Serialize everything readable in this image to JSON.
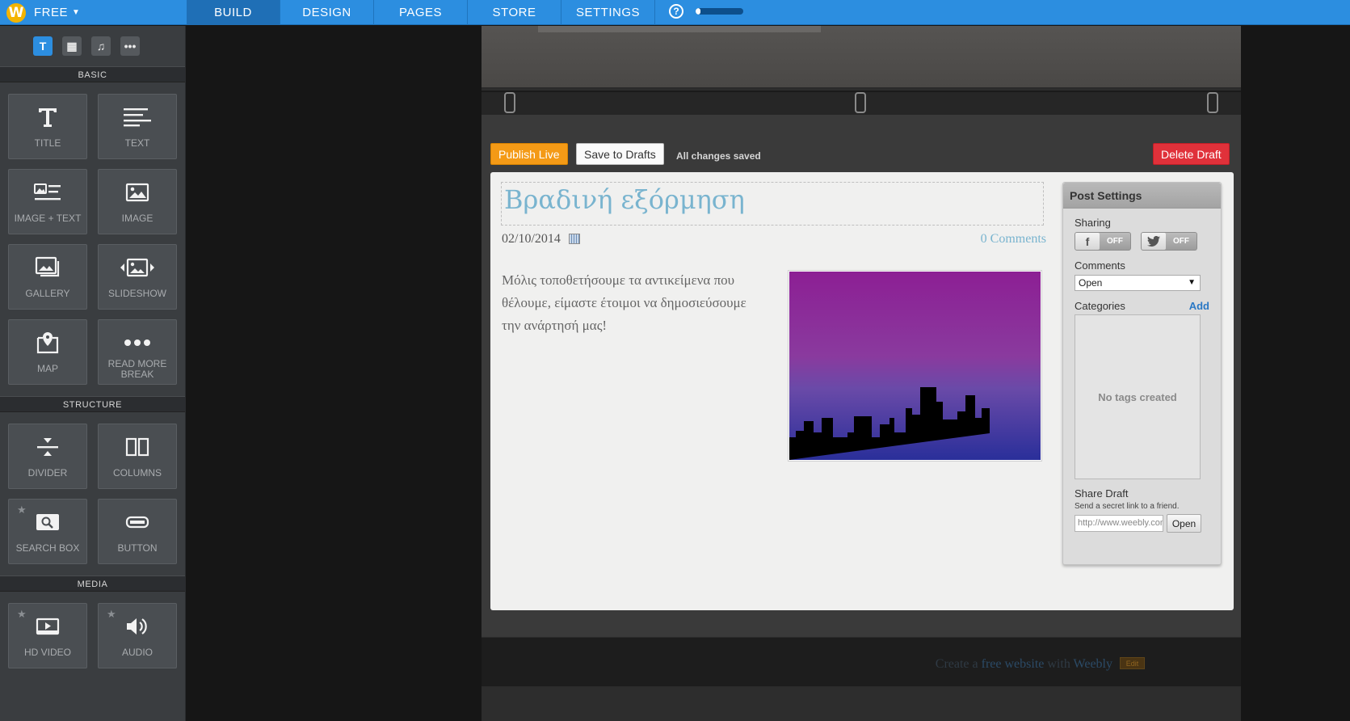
{
  "topbar": {
    "plan": "FREE",
    "tabs": [
      {
        "label": "BUILD",
        "active": true
      },
      {
        "label": "DESIGN",
        "active": false
      },
      {
        "label": "PAGES",
        "active": false
      },
      {
        "label": "STORE",
        "active": false
      },
      {
        "label": "SETTINGS",
        "active": false
      }
    ],
    "help": "?",
    "progress_fraction": 0.1,
    "accent_color": "#2c8ee0"
  },
  "sidebar": {
    "toolbar": [
      {
        "icon": "text-icon",
        "glyph": "T",
        "active": true
      },
      {
        "icon": "layout-icon",
        "glyph": "▦",
        "active": false
      },
      {
        "icon": "music-icon",
        "glyph": "♫",
        "active": false
      },
      {
        "icon": "more-icon",
        "glyph": "•••",
        "active": false
      }
    ],
    "sections": {
      "basic": "BASIC",
      "structure": "STRUCTURE",
      "media": "MEDIA"
    },
    "basic_elements": [
      {
        "label": "TITLE",
        "icon": "title-icon"
      },
      {
        "label": "TEXT",
        "icon": "text-lines-icon"
      },
      {
        "label": "IMAGE + TEXT",
        "icon": "image-text-icon"
      },
      {
        "label": "IMAGE",
        "icon": "image-icon"
      },
      {
        "label": "GALLERY",
        "icon": "gallery-icon"
      },
      {
        "label": "SLIDESHOW",
        "icon": "slideshow-icon"
      },
      {
        "label": "MAP",
        "icon": "map-pin-icon"
      },
      {
        "label": "READ MORE BREAK",
        "icon": "dots-icon"
      }
    ],
    "structure_elements": [
      {
        "label": "DIVIDER",
        "icon": "divider-icon"
      },
      {
        "label": "COLUMNS",
        "icon": "columns-icon"
      },
      {
        "label": "SEARCH BOX",
        "icon": "search-box-icon",
        "premium": true
      },
      {
        "label": "BUTTON",
        "icon": "button-icon"
      }
    ],
    "media_elements": [
      {
        "label": "HD VIDEO",
        "icon": "video-icon",
        "premium": true
      },
      {
        "label": "AUDIO",
        "icon": "audio-icon",
        "premium": true
      }
    ]
  },
  "editor": {
    "publish_label": "Publish Live",
    "save_label": "Save to Drafts",
    "status": "All changes saved",
    "delete_label": "Delete Draft"
  },
  "post": {
    "title": "Βραδινή εξόρμηση",
    "date": "02/10/2014",
    "comments": "0 Comments",
    "body": "Μόλις τοποθετήσουμε τα αντικείμενα που θέλουμε, είμαστε έτοιμοι να δημοσιεύσουμε την ανάρτησή μας!"
  },
  "post_settings": {
    "header": "Post Settings",
    "sharing_label": "Sharing",
    "facebook": {
      "glyph": "f",
      "state": "OFF"
    },
    "twitter": {
      "glyph": "🐦",
      "state": "OFF"
    },
    "comments_label": "Comments",
    "comments_value": "Open",
    "categories_label": "Categories",
    "add_label": "Add",
    "empty_tags": "No tags created",
    "share_draft_label": "Share Draft",
    "share_draft_sub": "Send a secret link to a friend.",
    "share_url": "http://www.weebly.com",
    "open_label": "Open"
  },
  "footer": {
    "text_pre": "Create a ",
    "text_link": "free website",
    "text_mid": " with ",
    "text_brand": "Weebly",
    "edit_label": "Edit"
  }
}
